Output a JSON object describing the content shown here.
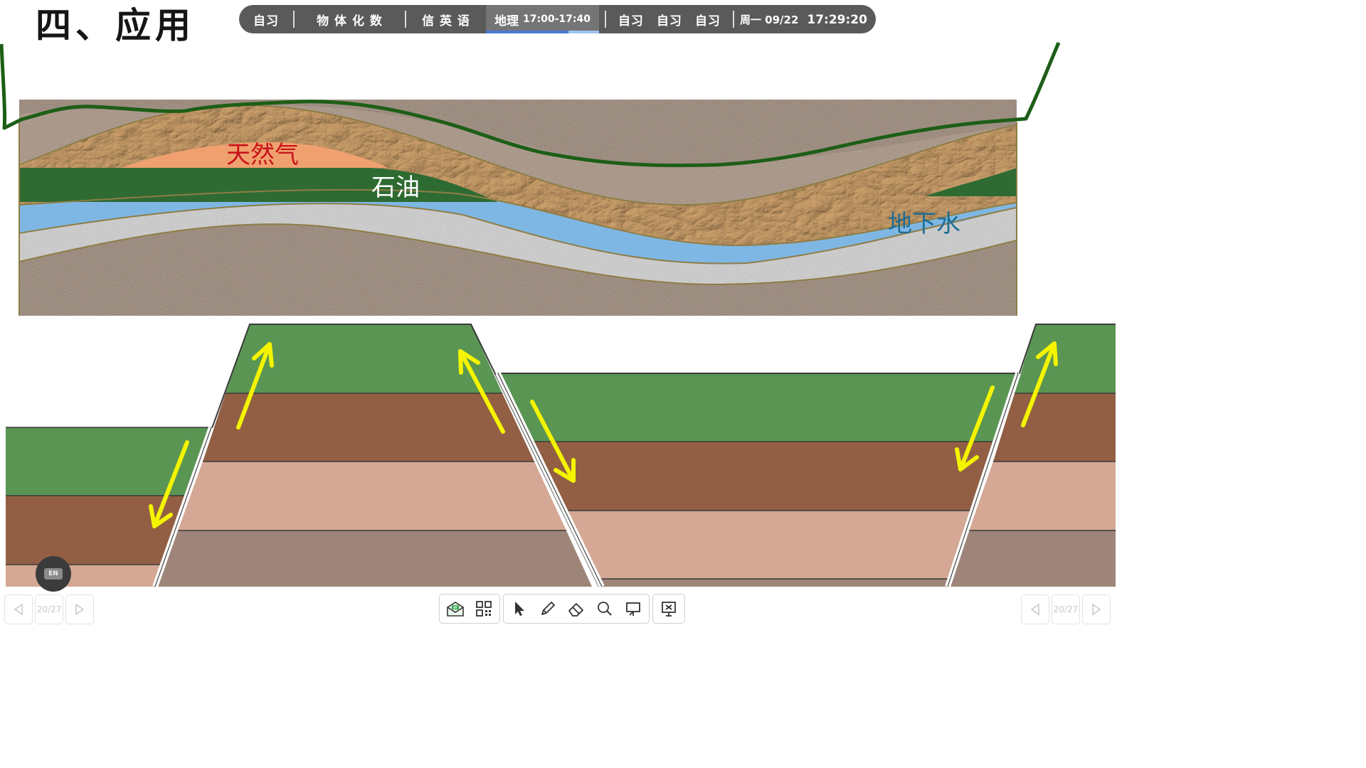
{
  "slide": {
    "title": "四、应用"
  },
  "schedule": {
    "items": [
      {
        "label": "自习"
      },
      {
        "label": "物 体 化 数"
      },
      {
        "label": "信 英 语"
      }
    ],
    "current": {
      "subject": "地理",
      "time": "17:00-17:40",
      "progress": 0.73
    },
    "after": [
      {
        "label": "自习"
      },
      {
        "label": "自习"
      },
      {
        "label": "自习"
      }
    ],
    "date": "周一 09/22",
    "clock": "17:29:20"
  },
  "diagram": {
    "labels": {
      "gas": "天然气",
      "oil": "石油",
      "water": "地下水"
    },
    "colors": {
      "gas_text": "#c8141a",
      "oil_text": "#ffffff",
      "water_text": "#1d6d94",
      "gas_fill": "#f0a06e",
      "oil_fill": "#2e6b32",
      "water_fill": "#7fb7e4",
      "topsoil": "#5a9553",
      "layer2": "#925f44",
      "layer3": "#d4a894",
      "layer4": "#9e8579",
      "arrow": "#f4f400"
    }
  },
  "toolbar": {
    "tools": [
      {
        "icon": "envelope-icon",
        "name": "message-tool"
      },
      {
        "icon": "qr-code-icon",
        "name": "qr-tool"
      },
      {
        "icon": "cursor-icon",
        "name": "select-tool"
      },
      {
        "icon": "pen-icon",
        "name": "pen-tool"
      },
      {
        "icon": "eraser-icon",
        "name": "eraser-tool"
      },
      {
        "icon": "search-icon",
        "name": "magnifier-tool"
      },
      {
        "icon": "board-icon",
        "name": "whiteboard-tool"
      },
      {
        "icon": "exit-slideshow-icon",
        "name": "exit-tool"
      }
    ]
  },
  "pager": {
    "page": "20/27"
  },
  "ime": {
    "label": "EN"
  }
}
